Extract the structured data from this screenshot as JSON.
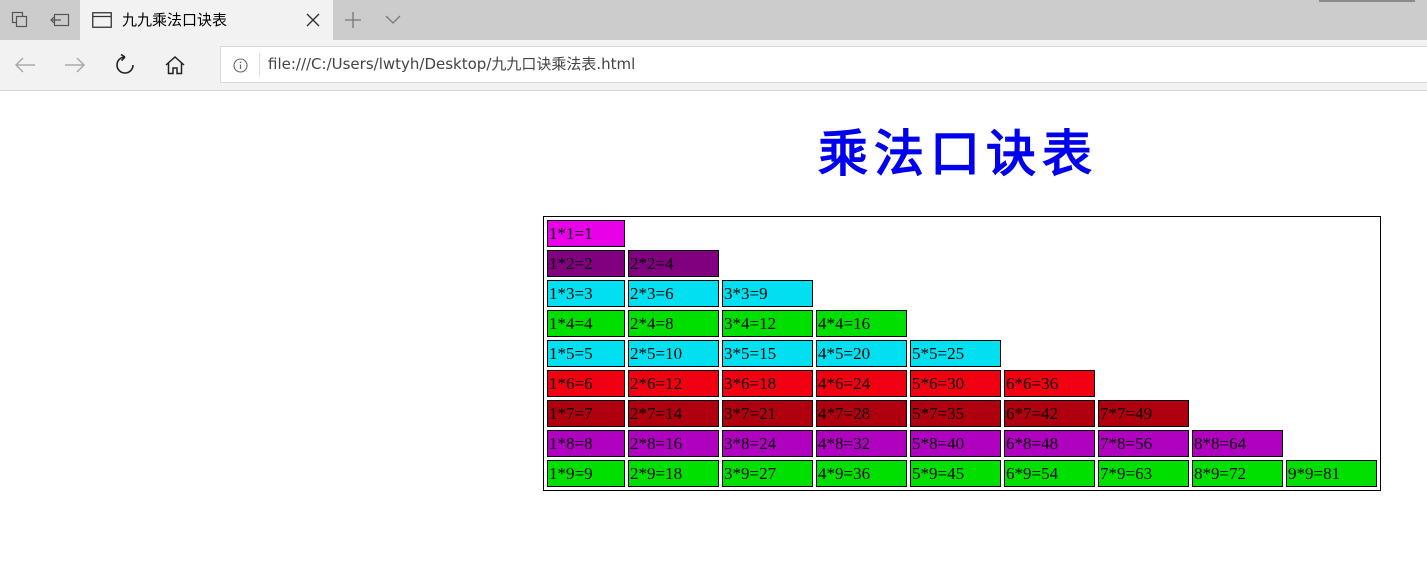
{
  "browser": {
    "tab": {
      "title": "九九乘法口诀表"
    },
    "address": {
      "url": "file:///C:/Users/lwtyh/Desktop/九九口诀乘法表.html"
    }
  },
  "page": {
    "heading": "乘法口诀表",
    "table": {
      "row_colors": [
        "#e800e8",
        "#800080",
        "#00e0f0",
        "#00e000",
        "#00e0f0",
        "#f00010",
        "#b00010",
        "#b000c0",
        "#00e000"
      ],
      "rows": [
        [
          "1*1=1"
        ],
        [
          "1*2=2",
          "2*2=4"
        ],
        [
          "1*3=3",
          "2*3=6",
          "3*3=9"
        ],
        [
          "1*4=4",
          "2*4=8",
          "3*4=12",
          "4*4=16"
        ],
        [
          "1*5=5",
          "2*5=10",
          "3*5=15",
          "4*5=20",
          "5*5=25"
        ],
        [
          "1*6=6",
          "2*6=12",
          "3*6=18",
          "4*6=24",
          "5*6=30",
          "6*6=36"
        ],
        [
          "1*7=7",
          "2*7=14",
          "3*7=21",
          "4*7=28",
          "5*7=35",
          "6*7=42",
          "7*7=49"
        ],
        [
          "1*8=8",
          "2*8=16",
          "3*8=24",
          "4*8=32",
          "5*8=40",
          "6*8=48",
          "7*8=56",
          "8*8=64"
        ],
        [
          "1*9=9",
          "2*9=18",
          "3*9=27",
          "4*9=36",
          "5*9=45",
          "6*9=54",
          "7*9=63",
          "8*9=72",
          "9*9=81"
        ]
      ]
    }
  }
}
